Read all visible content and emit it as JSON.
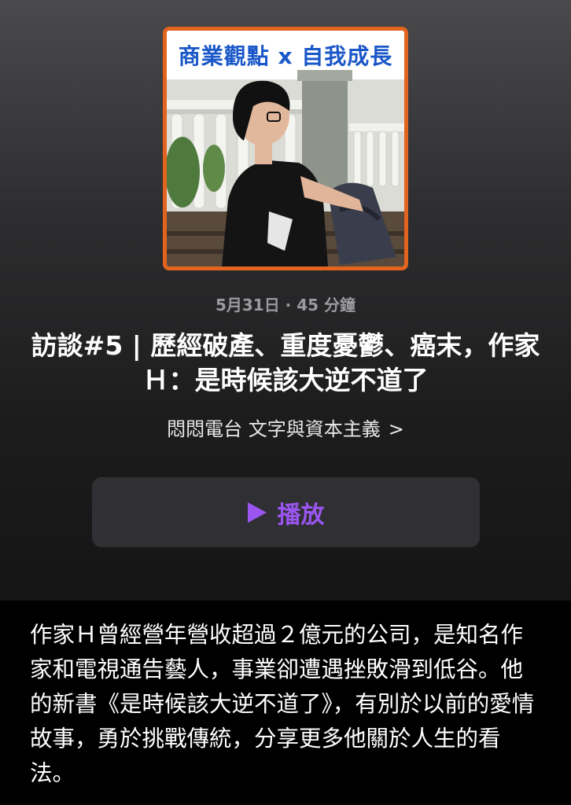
{
  "cover": {
    "title": "商業觀點 x 自我成長",
    "accent_color": "#e2641f",
    "title_color": "#1a57c8"
  },
  "episode": {
    "meta": "5月31日 · 45 分鐘",
    "title": "訪談#5 | 歷經破產、重度憂鬱、癌末，作家Ｈ：是時候該大逆不道了"
  },
  "show": {
    "name": "悶悶電台 文字與資本主義",
    "chevron_icon": "chevron-right-icon"
  },
  "play_button": {
    "label": "播放",
    "icon": "play-icon",
    "color": "#9b55f0"
  },
  "description": "作家Ｈ曾經營年營收超過２億元的公司，是知名作家和電視通告藝人，事業卻遭遇挫敗滑到低谷。他的新書《是時候該大逆不道了》，有別於以前的愛情故事，勇於挑戰傳統，分享更多他關於人生的看法。"
}
